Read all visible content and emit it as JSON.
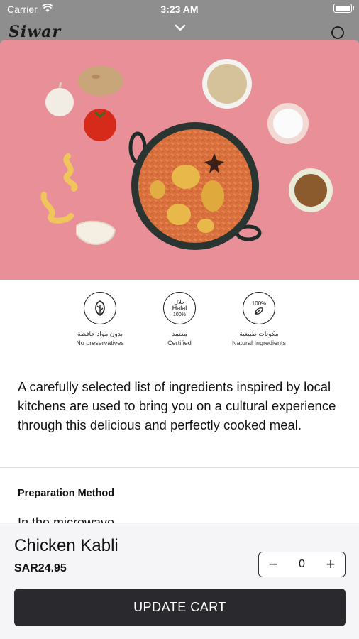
{
  "status": {
    "carrier": "Carrier",
    "time": "3:23 AM"
  },
  "app": {
    "logo": "Siwar"
  },
  "badges": [
    {
      "icon": "leaf-icon",
      "arabic": "بدون مواد حافظة",
      "english": "No preservatives"
    },
    {
      "icon": "halal-icon",
      "arabic": "معتمد",
      "english": "Certified",
      "seal_ar": "حلال",
      "seal_en": "Halal",
      "seal_pct": "100%"
    },
    {
      "icon": "natural-icon",
      "arabic": "مكونات طبيعية",
      "english": "Natural Ingredients",
      "seal_pct": "100%"
    }
  ],
  "description": "A carefully selected list of ingredients inspired by local kitchens are used to bring you on a cultural experience through this delicious and perfectly cooked meal.",
  "preparation": {
    "title": "Preparation Method",
    "peek": "In the microwave"
  },
  "product": {
    "name": "Chicken Kabli",
    "price": "SAR24.95",
    "quantity": "0",
    "minus": "−",
    "plus": "+"
  },
  "cart_button": "UPDATE CART",
  "colors": {
    "hero_bg": "#e88f98",
    "button_bg": "#2a2a2e"
  }
}
